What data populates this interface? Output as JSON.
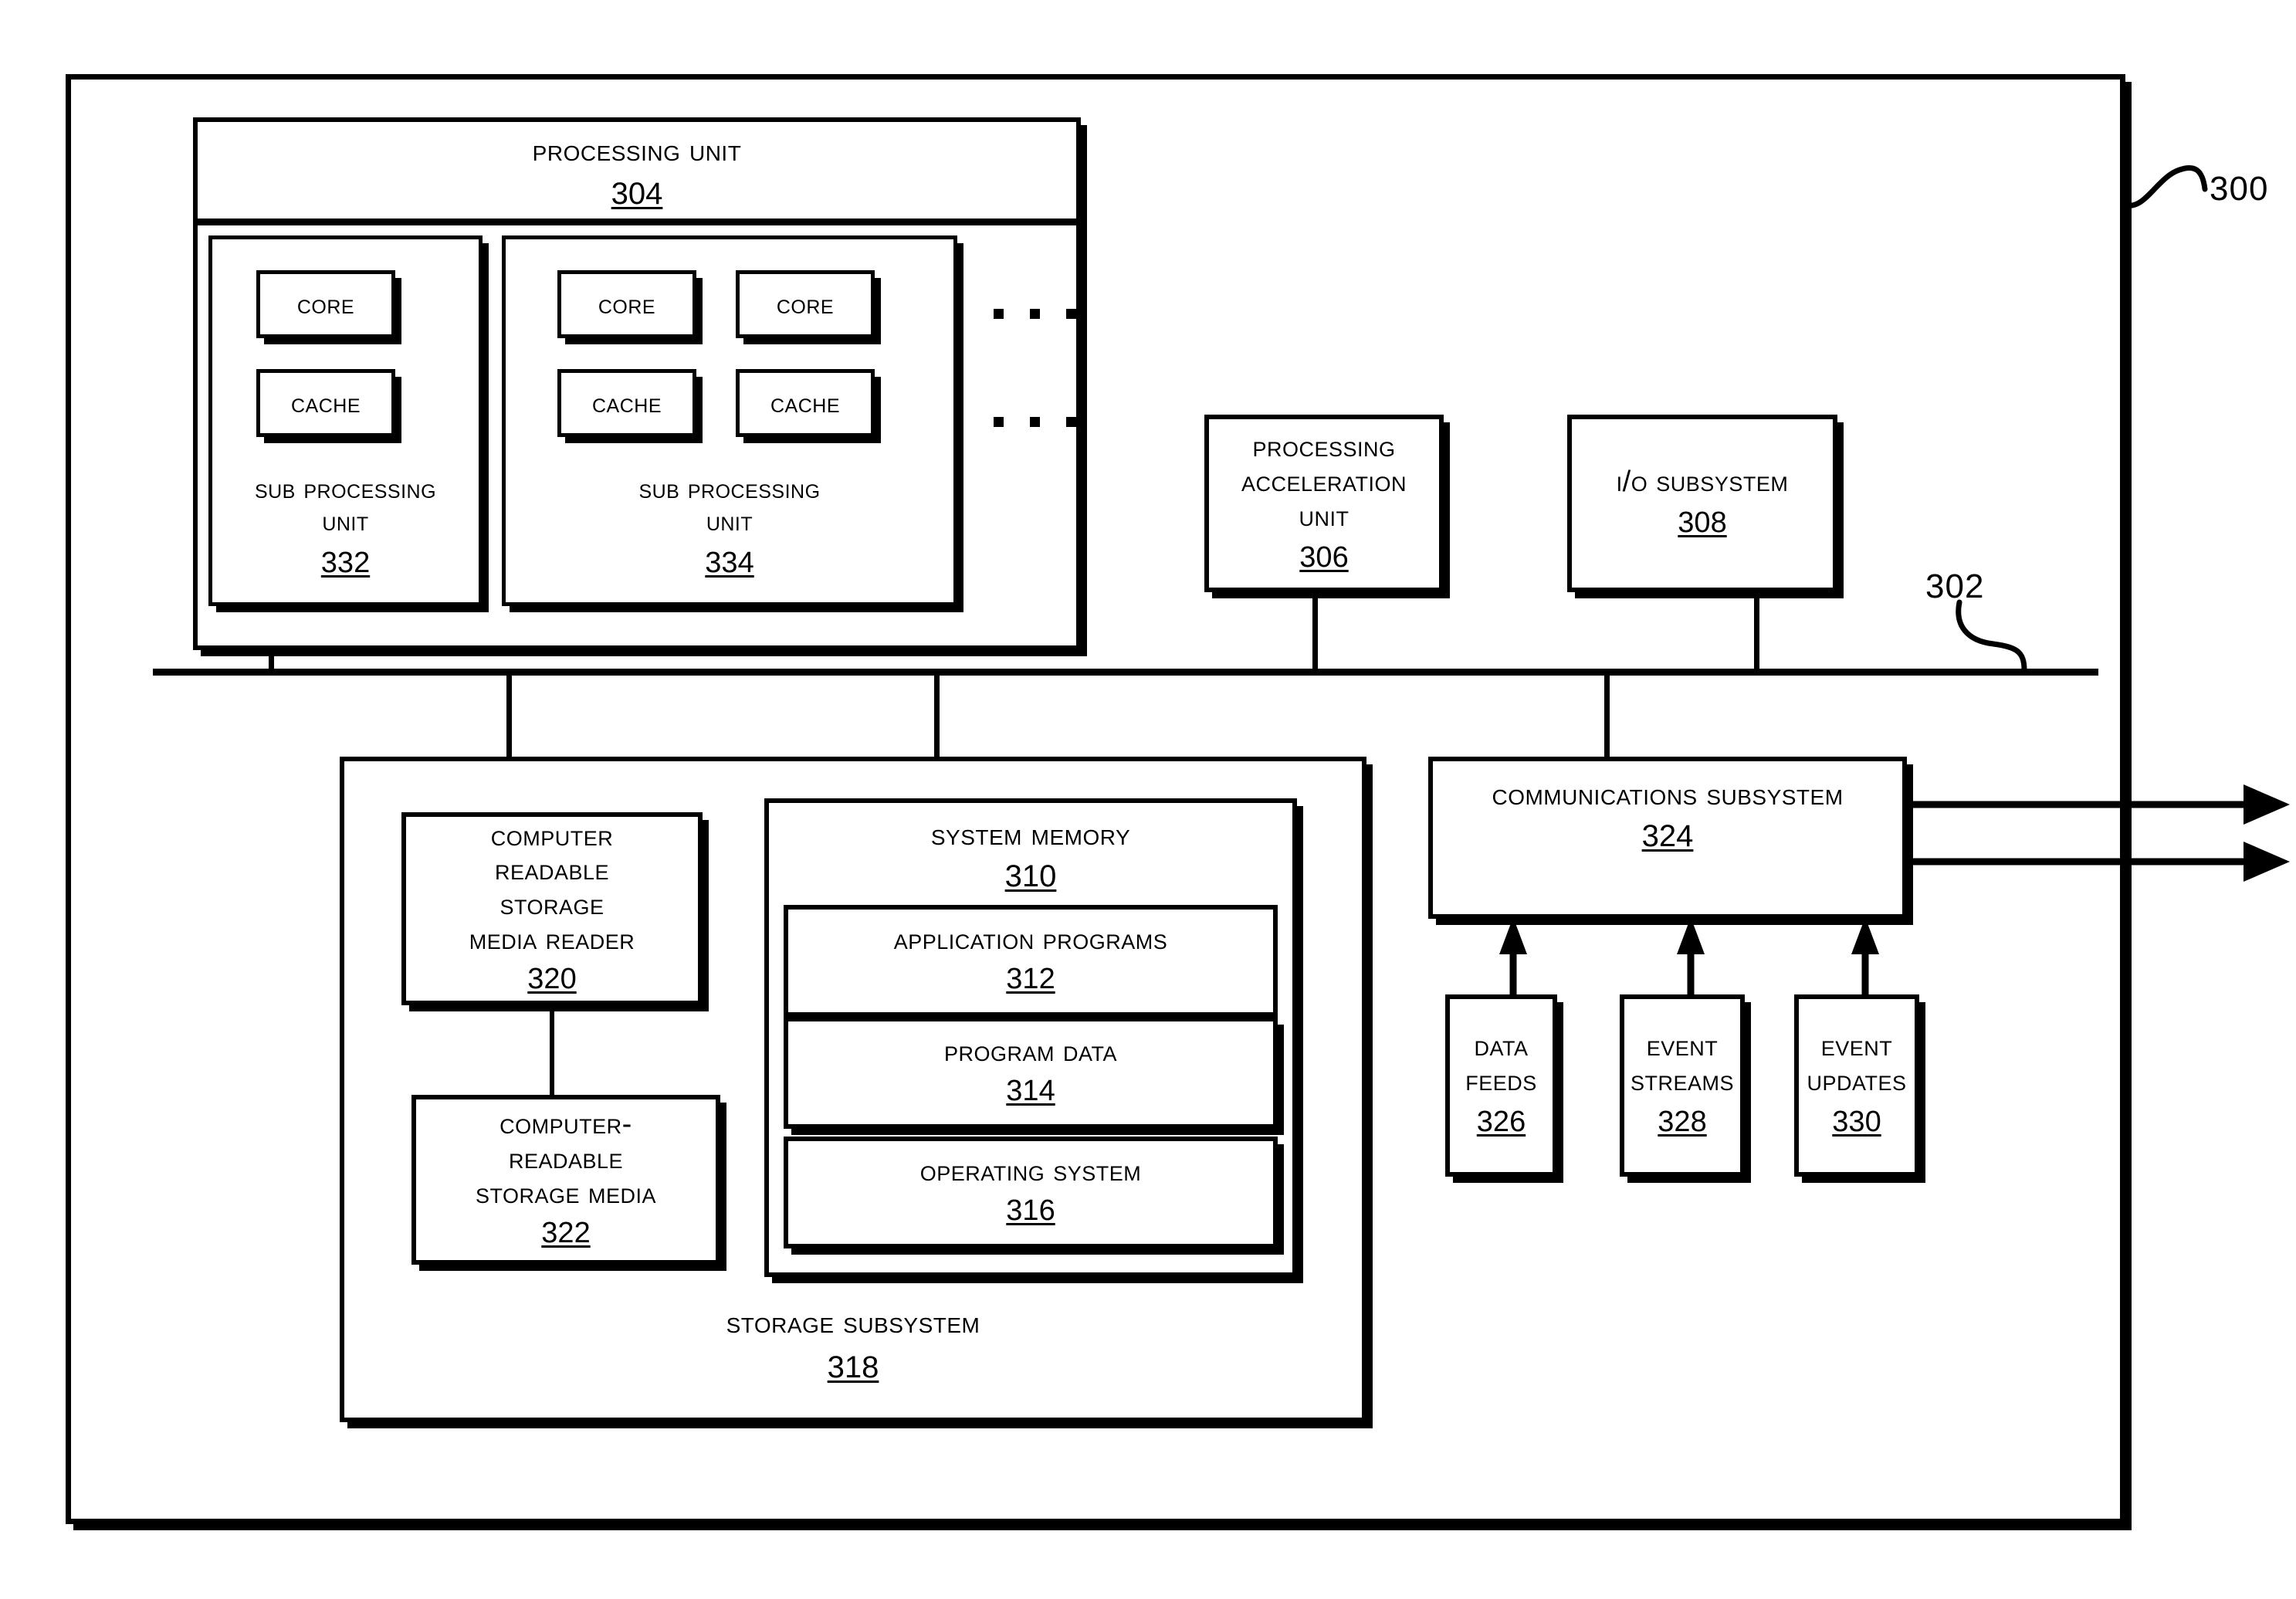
{
  "figure": {
    "outer_ref": "300",
    "bus_ref": "302"
  },
  "processing_unit": {
    "label": "Processing unit",
    "ref": "304",
    "ellipsis_rows": 2,
    "ellipsis_dots": 3,
    "sub_units": [
      {
        "label": "Sub processing\nunit",
        "ref": "332",
        "cores": [
          "Core"
        ],
        "caches": [
          "Cache"
        ]
      },
      {
        "label": "Sub processing\nunit",
        "ref": "334",
        "cores": [
          "Core",
          "Core"
        ],
        "caches": [
          "Cache",
          "Cache"
        ]
      }
    ]
  },
  "acceleration_unit": {
    "label": "Processing\nAcceleration\nUnit",
    "ref": "306"
  },
  "io_subsystem": {
    "label": "I/O Subsystem",
    "ref": "308"
  },
  "storage_subsystem": {
    "label": "Storage Subsystem",
    "ref": "318",
    "media_reader": {
      "label": "Computer\nReadable\nStorage\nMedia Reader",
      "ref": "320"
    },
    "storage_media": {
      "label": "Computer-\nReadable\nStorage Media",
      "ref": "322"
    },
    "system_memory": {
      "label": "System Memory",
      "ref": "310",
      "items": [
        {
          "label": "Application Programs",
          "ref": "312"
        },
        {
          "label": "Program Data",
          "ref": "314"
        },
        {
          "label": "Operating System",
          "ref": "316"
        }
      ]
    }
  },
  "communications_subsystem": {
    "label": "Communications Subsystem",
    "ref": "324",
    "inputs": [
      {
        "label": "Data\nFeeds",
        "ref": "326"
      },
      {
        "label": "Event\nStreams",
        "ref": "328"
      },
      {
        "label": "Event\nUpdates",
        "ref": "330"
      }
    ],
    "output_arrows": 2
  },
  "colors": {
    "ink": "#000000",
    "paper": "#ffffff"
  }
}
